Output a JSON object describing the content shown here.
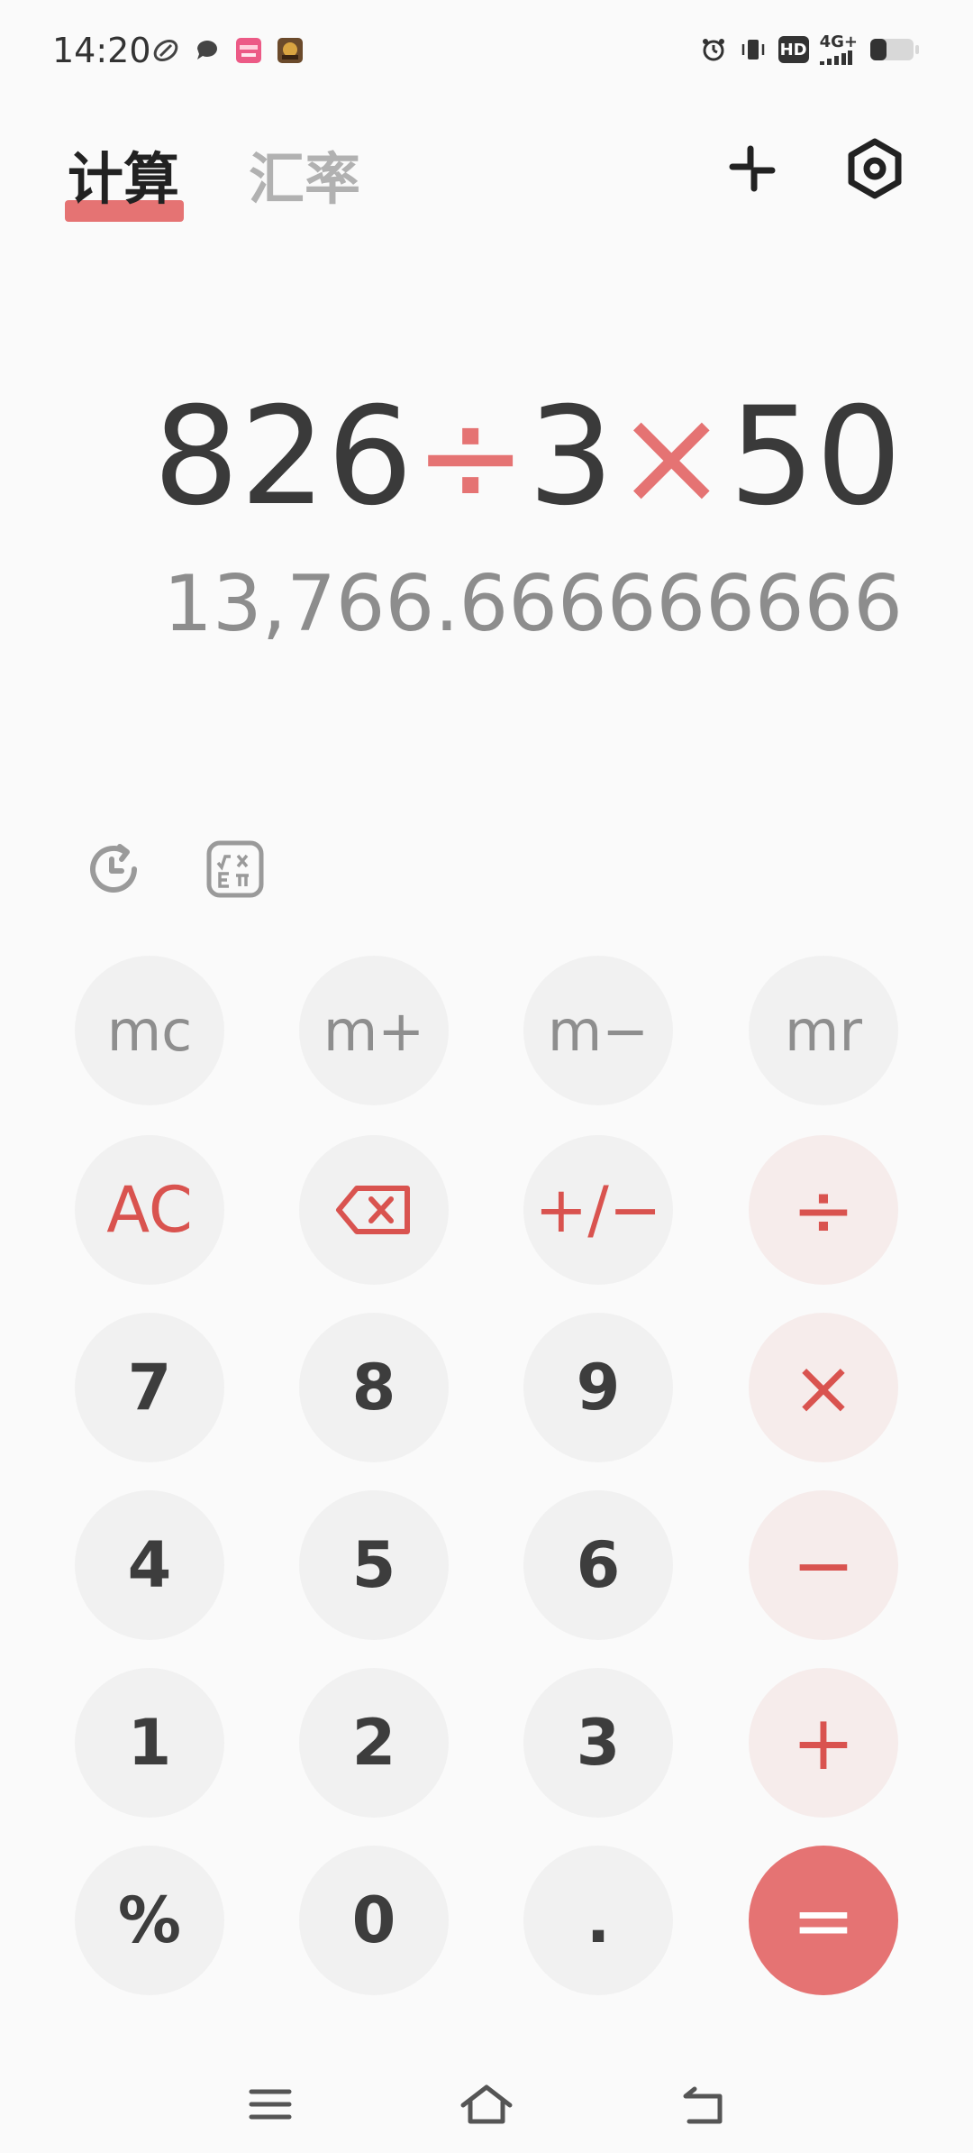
{
  "status_bar": {
    "time": "14:20",
    "left_icons": [
      "rugby-ball-icon",
      "chat-bubble-icon",
      "app-badge-pink-icon",
      "app-badge-game-icon"
    ],
    "right_icons": [
      "alarm-icon",
      "vibrate-icon",
      "hd-icon",
      "signal-4g-icon",
      "battery-icon"
    ],
    "hd_label": "HD",
    "network_label": "4G+"
  },
  "header": {
    "tabs": [
      {
        "label": "计算",
        "active": true
      },
      {
        "label": "汇率",
        "active": false
      }
    ]
  },
  "display": {
    "expression": {
      "operand1": "826",
      "op1": "÷",
      "operand2": "3",
      "op2": "×",
      "operand3": "50"
    },
    "result": "13,766.666666666"
  },
  "keypad": {
    "memory": [
      "mc",
      "m+",
      "m−",
      "mr"
    ],
    "func": [
      "AC",
      "backspace",
      "+/−",
      "÷"
    ],
    "row7": [
      "7",
      "8",
      "9",
      "×"
    ],
    "row4": [
      "4",
      "5",
      "6",
      "−"
    ],
    "row1": [
      "1",
      "2",
      "3",
      "+"
    ],
    "row0": [
      "%",
      "0",
      ".",
      "="
    ]
  },
  "colors": {
    "accent": "#e57373",
    "operator": "#d9534f",
    "key_bg": "#f1f1f1",
    "op_bg": "#f6eceb",
    "background": "#fafafa"
  }
}
